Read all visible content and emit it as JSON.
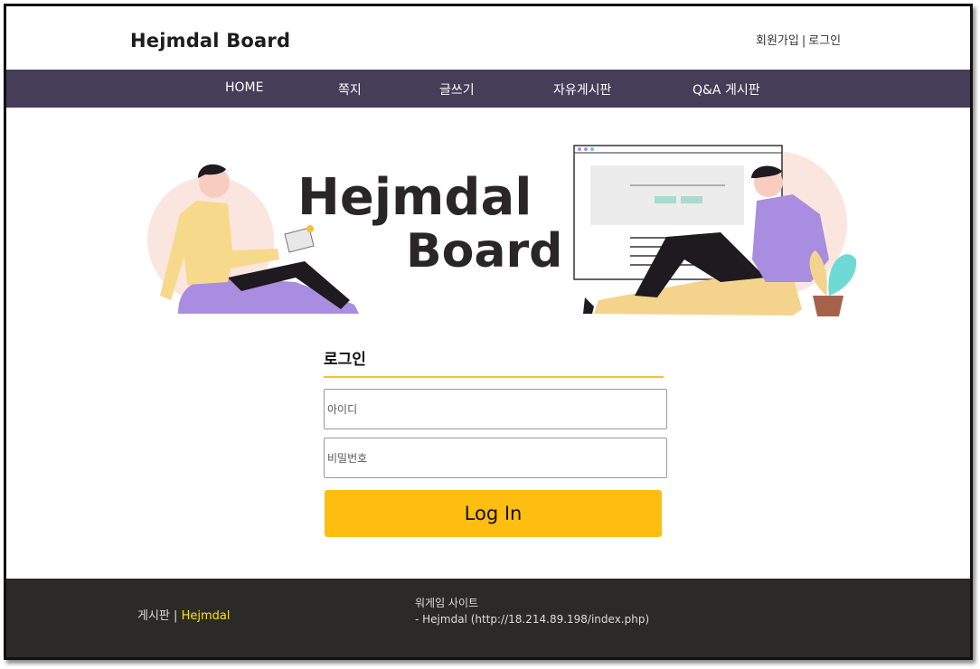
{
  "header": {
    "logo": "Hejmdal Board",
    "signup": "회원가입",
    "separator": "|",
    "login": "로그인"
  },
  "nav": {
    "items": [
      "HOME",
      "쪽지",
      "글쓰기",
      "자유게시판",
      "Q&A 게시판"
    ]
  },
  "hero": {
    "title_line1": "Hejmdal",
    "title_line2": "Board"
  },
  "login": {
    "title": "로그인",
    "id_placeholder": "아이디",
    "pw_placeholder": "비밀번호",
    "button": "Log In"
  },
  "footer": {
    "left_label": "게시판",
    "left_sep": "|",
    "left_brand": "Hejmdal",
    "site_title": "워게임 사이트",
    "site_link": "- Hejmdal (http://18.214.89.198/index.php)"
  },
  "colors": {
    "nav_bg": "#463d58",
    "accent": "#fdbd11",
    "footer_bg": "#2c2a28",
    "footer_brand": "#ffe400"
  }
}
